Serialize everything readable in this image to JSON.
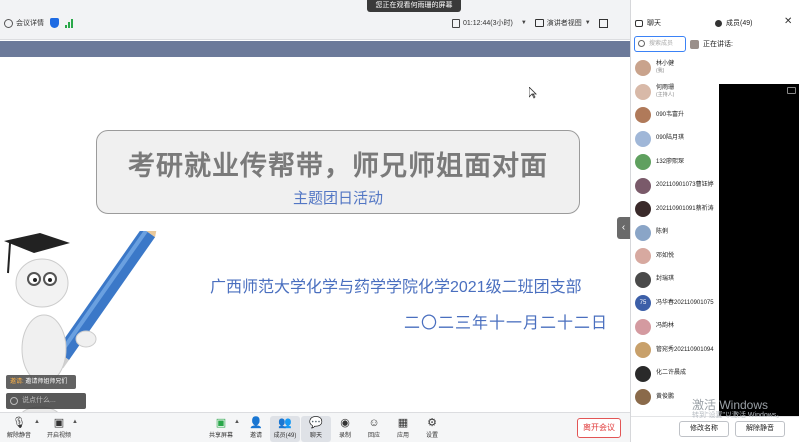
{
  "sharing_banner": "您正在观看何雨珊的屏幕",
  "topbar": {
    "meeting_info": "会议详情",
    "timer": "01:12:44(3小时)",
    "view_mode": "演讲者视图"
  },
  "slide": {
    "title": "考研就业传帮带，师兄师姐面对面",
    "subtitle": "主题团日活动",
    "organization": "广西师范大学化学与药学学院化学2021级二班团支部",
    "date": "二〇二三年十一月二十二日"
  },
  "overlay": {
    "invite_tag": "邀请:",
    "invite_text": "邀请师姐师兄们",
    "say_placeholder": "说点什么..."
  },
  "toolbar": {
    "unmute": "解除静音",
    "video": "开启视频",
    "share": "共享屏幕",
    "invite": "邀请",
    "members": "成员(49)",
    "chat": "聊天",
    "record": "录制",
    "reactions": "回应",
    "apps": "应用",
    "settings": "设置",
    "leave": "离开会议"
  },
  "panel": {
    "chat_tab": "聊天",
    "members_tab": "成员(49)",
    "search_placeholder": "搜索成员",
    "speaking_label": "正在讲话:",
    "rename": "修改名称",
    "unmute_all": "解除静音"
  },
  "members": [
    {
      "name": "林小健",
      "role": "(我)",
      "color": "#c9a38c"
    },
    {
      "name": "何雨珊",
      "role": "(主持人)",
      "color": "#d8b9a8"
    },
    {
      "name": "090韦富升",
      "role": "",
      "color": "#b07a5a"
    },
    {
      "name": "090陆月琪",
      "role": "",
      "color": "#a0b7d8"
    },
    {
      "name": "132廖熙琛",
      "role": "",
      "color": "#5fa05f"
    },
    {
      "name": "202110901073曹钰婷",
      "role": "",
      "color": "#7a5a6a"
    },
    {
      "name": "202110901091蔡祈涛",
      "role": "",
      "color": "#3a2a2a"
    },
    {
      "name": "陈俐",
      "role": "",
      "color": "#8aa5c7"
    },
    {
      "name": "邓如悦",
      "role": "",
      "color": "#d7a9a0"
    },
    {
      "name": "封瑞琪",
      "role": "",
      "color": "#4a4a4a"
    },
    {
      "name": "冯华春202110901075",
      "role": "",
      "color": "#3c5fa8",
      "initials": "75"
    },
    {
      "name": "冯韵林",
      "role": "",
      "color": "#d49aa0"
    },
    {
      "name": "管宛秀202110901094",
      "role": "",
      "color": "#c8a06a"
    },
    {
      "name": "化二许晨成",
      "role": "",
      "color": "#2a2a2a"
    },
    {
      "name": "黄俊鹏",
      "role": "",
      "color": "#8a6a4a"
    }
  ],
  "watermark": {
    "title": "激活 Windows",
    "subtitle": "转到\"设置\"以激活 Windows。"
  }
}
